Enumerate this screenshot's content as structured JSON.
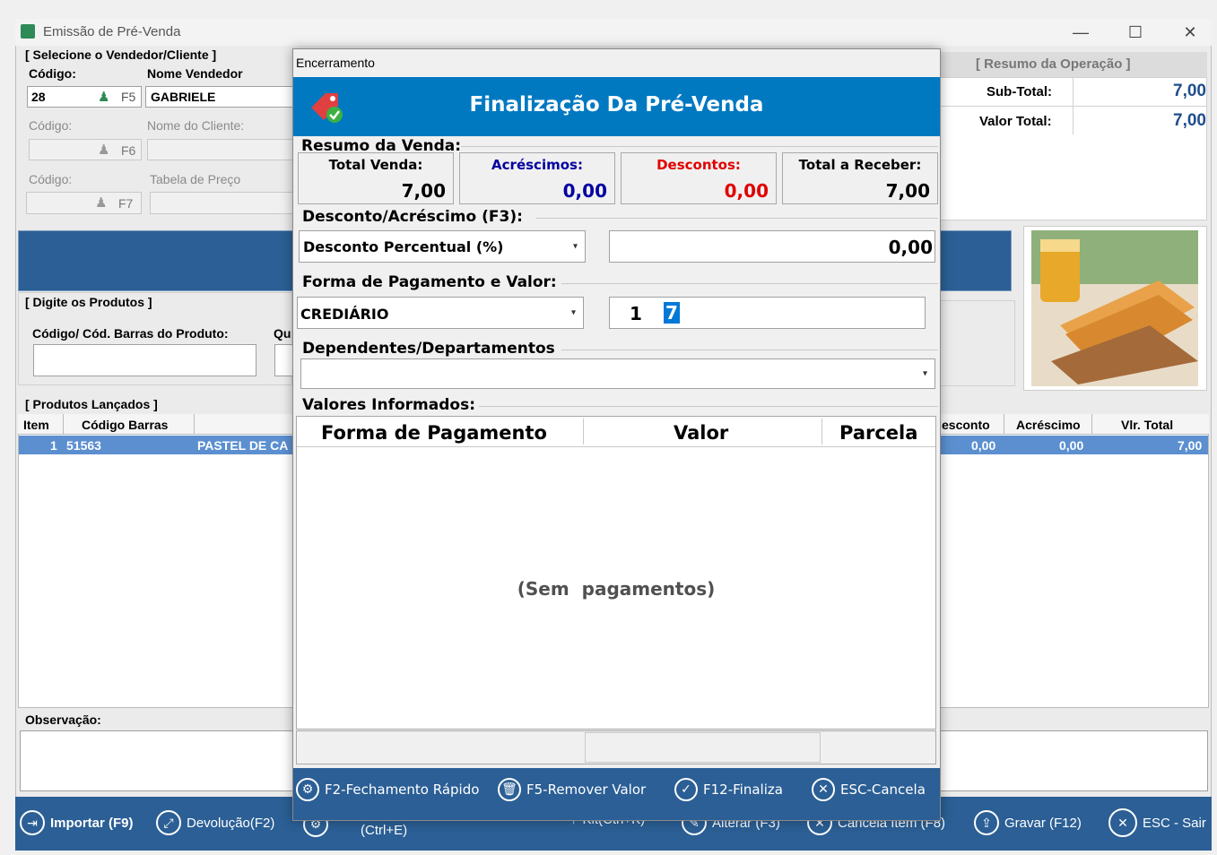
{
  "window": {
    "title": "Emissão de Pré-Venda",
    "minimize": "—",
    "maximize": "☐",
    "close": "✕"
  },
  "seller": {
    "section_title": "[ Selecione o Vendedor/Cliente ]",
    "code_label": "Código:",
    "name_label": "Nome Vendedor",
    "code_value": "28",
    "shortcut": "F5",
    "name_value": "GABRIELE"
  },
  "client": {
    "code_label": "Código:",
    "name_label": "Nome do Cliente:",
    "shortcut": "F6"
  },
  "price_table": {
    "code_label": "Código:",
    "label": "Tabela de Preço",
    "shortcut": "F7"
  },
  "summary": {
    "title": "[ Resumo da Operação ]",
    "subtotal_label": "Sub-Total:",
    "subtotal_value": "7,00",
    "total_label": "Valor Total:",
    "total_value": "7,00"
  },
  "products_entry": {
    "title": "[ Digite os Produtos ]",
    "code_label": "Código/ Cód. Barras do Produto:",
    "qty_label_partial": "Qu"
  },
  "products_table": {
    "title": "[ Produtos Lançados ]",
    "headers_left": [
      "Item",
      "Código Barras"
    ],
    "headers_right": [
      "esconto",
      "Acréscimo",
      "Vlr. Total"
    ],
    "rows": [
      {
        "item": "1",
        "barcode": "51563",
        "desc": "PASTEL DE CA",
        "desconto": "0,00",
        "acrescimo": "0,00",
        "total": "7,00"
      }
    ]
  },
  "observation": {
    "label": "Observação:"
  },
  "toolbar": {
    "import": "Importar (F9)",
    "return": "Devolução(F2)",
    "ctrl_e": "(Ctrl+E)",
    "kit": "Kit(Ctrl+K)",
    "alter": "Alterar (F3)",
    "cancel_item": "Cancela Item (F8)",
    "save": "Gravar (F12)",
    "exit": "ESC - Sair"
  },
  "dialog": {
    "title": "Encerramento",
    "header": "Finalização Da Pré-Venda",
    "resume_label": "Resumo da Venda:",
    "total_sale_label": "Total Venda:",
    "total_sale_value": "7,00",
    "additions_label": "Acréscimos:",
    "additions_value": "0,00",
    "discounts_label": "Descontos:",
    "discounts_value": "0,00",
    "receive_label": "Total a Receber:",
    "receive_value": "7,00",
    "discount_section": "Desconto/Acréscimo (F3):",
    "discount_type": "Desconto Percentual (%)",
    "discount_value": "0,00",
    "payment_section": "Forma de Pagamento e Valor:",
    "payment_method": "CREDIÁRIO",
    "payment_code": "1",
    "payment_amount": "7",
    "dependents_section": "Dependentes/Departamentos",
    "informed_section": "Valores Informados:",
    "col_method": "Forma de Pagamento",
    "col_value": "Valor",
    "col_installment": "Parcela",
    "empty_text": "(Sem  pagamentos)",
    "btn_quick": "F2-Fechamento Rápido",
    "btn_remove": "F5-Remover Valor",
    "btn_finalize": "F12-Finaliza",
    "btn_cancel": "ESC-Cancela"
  },
  "colors": {
    "dialog_header": "#0079c1",
    "toolbar": "#2b5f95",
    "selected_row": "#5b8fd0",
    "discount_red": "#e00000",
    "addition_blue": "#0000a0"
  }
}
